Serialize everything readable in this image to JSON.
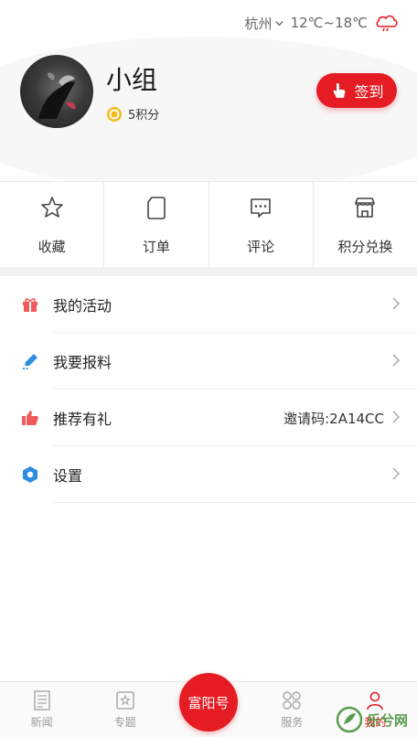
{
  "header": {
    "city": "杭州",
    "temperature": "12℃~18℃",
    "username": "小组",
    "points": "5积分",
    "signin_label": "签到"
  },
  "quick_actions": [
    {
      "label": "收藏",
      "icon": "star-icon"
    },
    {
      "label": "订单",
      "icon": "order-icon"
    },
    {
      "label": "评论",
      "icon": "comment-icon"
    },
    {
      "label": "积分兑换",
      "icon": "store-icon"
    }
  ],
  "menu": [
    {
      "label": "我的活动",
      "value": "",
      "icon": "gift-icon",
      "color": "#f05a5a"
    },
    {
      "label": "我要报料",
      "value": "",
      "icon": "pen-icon",
      "color": "#2d8de0"
    },
    {
      "label": "推荐有礼",
      "value": "邀请码:2A14CC",
      "icon": "thumbs-up-icon",
      "color": "#f05a5a"
    },
    {
      "label": "设置",
      "value": "",
      "icon": "hexagon-settings-icon",
      "color": "#2d8de0"
    }
  ],
  "tabbar": {
    "news": "新闻",
    "topics": "专题",
    "center": "富阳号",
    "services": "服务",
    "mine": "我的"
  },
  "watermark": "乐兮网",
  "colors": {
    "accent": "#e51c23",
    "blue": "#2d8de0"
  }
}
